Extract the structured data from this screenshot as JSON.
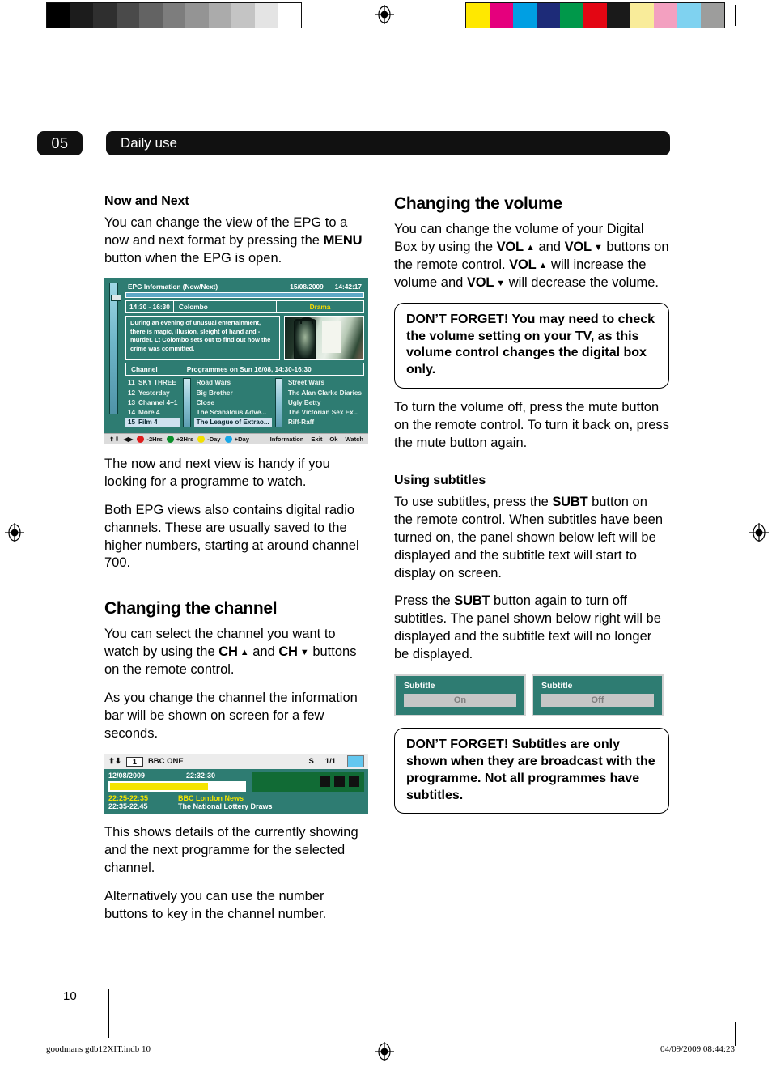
{
  "print_marks": {
    "greyscale_swatches": [
      "#000000",
      "#1c1c1c",
      "#2f2f2f",
      "#4a4a4a",
      "#636363",
      "#7d7d7d",
      "#949494",
      "#ababab",
      "#c4c4c4",
      "#e4e4e4",
      "#ffffff"
    ],
    "colour_swatches": [
      "#ffe800",
      "#e5007d",
      "#009fe3",
      "#1d2b78",
      "#00984a",
      "#e30613",
      "#1a1a1a",
      "#f9ec9a",
      "#f3a0c0",
      "#7fd2f0",
      "#9d9d9c"
    ],
    "registration_icon": "registration-target-icon"
  },
  "header": {
    "chapter_number": "05",
    "section_title": "Daily use"
  },
  "left_column": {
    "now_and_next_heading": "Now and Next",
    "now_and_next_body_1": "You can change the view of the EPG to a now and next format by pressing the ",
    "now_and_next_menu_key": "MENU",
    "now_and_next_body_2": " button when the EPG is open.",
    "epg_caption_1": "The now and next view is handy if you looking for a programme to watch.",
    "epg_caption_2": "Both EPG views also contains digital radio channels. These are usually saved to the higher numbers, starting at around channel 700.",
    "changing_channel_heading": "Changing the channel",
    "changing_channel_body_1a": "You can select the channel you want to watch by using the ",
    "changing_channel_ch_up": "CH",
    "changing_channel_body_1b": " and ",
    "changing_channel_ch_down": "CH",
    "changing_channel_body_1c": " buttons on the remote control.",
    "changing_channel_body_2": "As you change the channel the information bar will be shown on screen for a few seconds.",
    "infobar_caption_1": "This shows details of the currently showing and the next programme for the selected channel.",
    "infobar_caption_2": "Alternatively you can use the number buttons to key in the channel number."
  },
  "epg_screenshot": {
    "title": "EPG Information (Now/Next)",
    "date": "15/08/2009",
    "time": "14:42:17",
    "programme_time": "14:30 - 16:30",
    "programme_name": "Colombo",
    "genre": "Drama",
    "description": "During an evening of unusual entertainment, there is magic, illusion, sleight of hand and - murder. Lt Colombo sets out to find out how the crime was committed.",
    "thumbnail_icon": "programme-thumbnail-image",
    "list_header_channel": "Channel",
    "list_header_programmes": "Programmes on Sun 16/08,  14:30-16:30",
    "channels": [
      {
        "number": "11",
        "name": "SKY THREE",
        "now": "Road Wars",
        "next": "Street Wars",
        "selected": false
      },
      {
        "number": "12",
        "name": "Yesterday",
        "now": "Big Brother",
        "next": "The Alan Clarke Diaries",
        "selected": false
      },
      {
        "number": "13",
        "name": "Channel 4+1",
        "now": "Close",
        "next": "Ugly Betty",
        "selected": false
      },
      {
        "number": "14",
        "name": "More 4",
        "now": "The Scanalous Adve...",
        "next": "The Victorian Sex Ex...",
        "selected": false
      },
      {
        "number": "15",
        "name": "Film 4",
        "now": "The League of Extrao...",
        "next": "Riff-Raff",
        "selected": true
      }
    ],
    "footer": {
      "nav_icon": "up-down-arrows-icon",
      "lr_icon": "left-right-arrows-icon",
      "red_label": "-2Hrs",
      "green_label": "+2Hrs",
      "yellow_label": "-Day",
      "blue_label": "+Day",
      "information": "Information",
      "exit": "Exit",
      "ok": "Ok",
      "watch": "Watch"
    }
  },
  "infobar_screenshot": {
    "updown_icon": "up-down-arrows-icon",
    "channel_number": "1",
    "channel_name": "BBC ONE",
    "subtitle_flag": "S",
    "page_indicator": "1/1",
    "tv_icon": "tv-screen-icon",
    "date": "12/08/2009",
    "time": "22:32:30",
    "now_time": "22:25-22:35",
    "now_title": "BBC London News",
    "next_time": "22:35-22.45",
    "next_title": "The National Lottery Draws"
  },
  "right_column": {
    "changing_volume_heading": "Changing the volume",
    "volume_body_a": "You can change the volume of your Digital Box by using the ",
    "vol_key": "VOL",
    "volume_body_b": " and ",
    "volume_body_c": " buttons on the remote control. ",
    "volume_body_d": " will increase the volume and ",
    "volume_body_e": " will decrease the volume.",
    "callout_volume": "DON’T FORGET! You may need to check the volume setting on your TV, as this volume control changes the digital box only.",
    "mute_body": "To turn the volume off, press the mute button on the remote control. To turn it back on, press the mute button again.",
    "using_subtitles_heading": "Using subtitles",
    "subtitles_body_1a": "To use subtitles, press the ",
    "subt_key": "SUBT",
    "subtitles_body_1b": " button on the remote control. When subtitles have been turned on, the panel shown below left will be displayed and the subtitle text will start to display on screen.",
    "subtitles_body_2a": "Press the  ",
    "subtitles_body_2b": " button again to turn off subtitles. The panel shown below right will be displayed and the subtitle text will no longer be displayed.",
    "callout_subtitles": "DON’T FORGET! Subtitles are only shown when they are broadcast with the programme. Not all programmes have subtitles."
  },
  "subtitle_panels": [
    {
      "label": "Subtitle",
      "value": "On"
    },
    {
      "label": "Subtitle",
      "value": "Off"
    }
  ],
  "footer": {
    "page_number": "10",
    "file_info": "goodmans gdb12XIT.indb   10",
    "timestamp": "04/09/2009   08:44:23",
    "registration_icon": "registration-target-icon"
  },
  "colors": {
    "epg_teal": "#2e7c72",
    "header_black": "#111111",
    "genre_yellow": "#ffdd00",
    "progress_yellow": "#f4e400"
  }
}
